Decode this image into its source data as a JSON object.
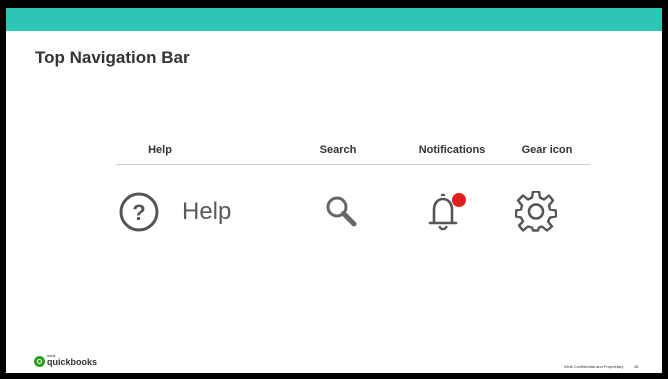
{
  "slide": {
    "title": "Top Navigation Bar",
    "accent_color": "#2ec4b6",
    "columns": [
      {
        "header": "Help",
        "icon": "help-circle-icon",
        "text": "Help"
      },
      {
        "header": "Search",
        "icon": "search-icon"
      },
      {
        "header": "Notifications",
        "icon": "bell-icon",
        "badge_color": "#e02020"
      },
      {
        "header": "Gear icon",
        "icon": "gear-icon"
      }
    ]
  },
  "footer": {
    "logo_brand": "quickbooks",
    "logo_maker": "intuit",
    "confidential": "Intuit Confidential and Proprietary",
    "page_number": "48"
  }
}
